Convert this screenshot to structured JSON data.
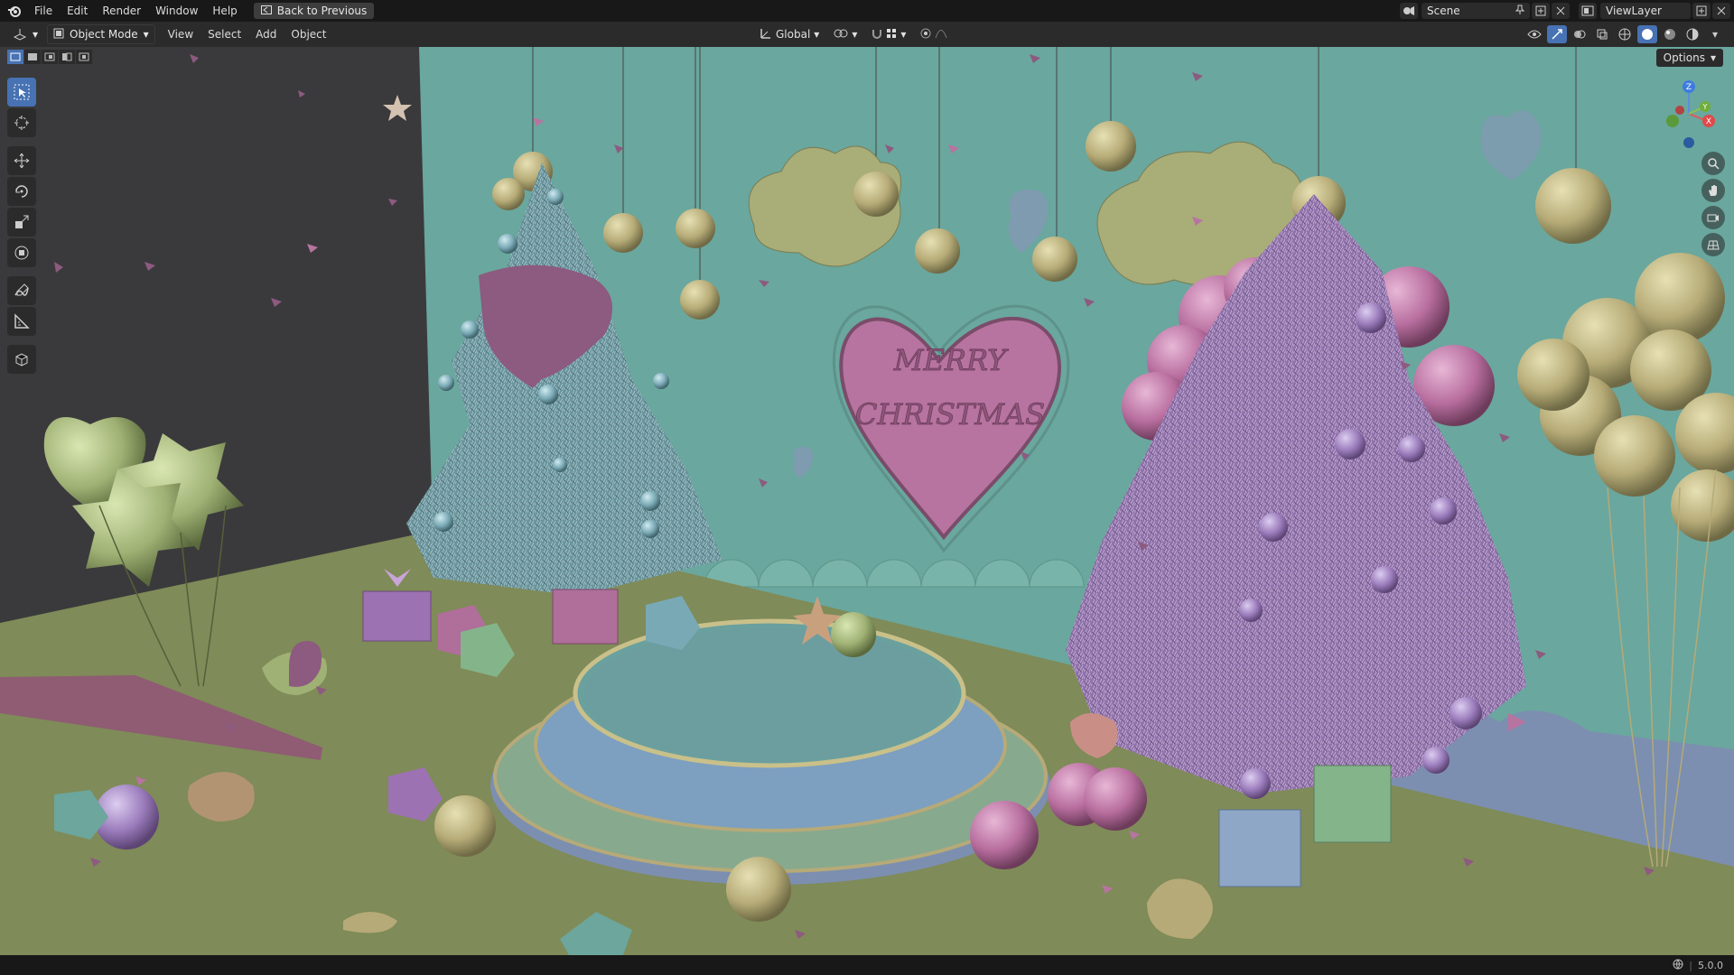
{
  "topbar": {
    "menus": [
      "File",
      "Edit",
      "Render",
      "Window",
      "Help"
    ],
    "back_button": "Back to Previous",
    "scene_name": "Scene",
    "view_layer": "ViewLayer"
  },
  "header": {
    "mode": "Object Mode",
    "menus": [
      "View",
      "Select",
      "Add",
      "Object"
    ],
    "transform_orientation": "Global"
  },
  "viewport": {
    "options_label": "Options",
    "banner_text_line1": "MERRY",
    "banner_text_line2": "CHRISTMAS",
    "gizmo_axes": [
      "Z",
      "Y",
      "X"
    ]
  },
  "statusbar": {
    "version": "5.0.0"
  },
  "colors": {
    "accent": "#4772b3",
    "wall": "#6aa79e",
    "floor": "#7f8b58",
    "pink": "#b774a0",
    "blue_tree": "#6f98a0",
    "purple_tree": "#9b7bb0"
  }
}
